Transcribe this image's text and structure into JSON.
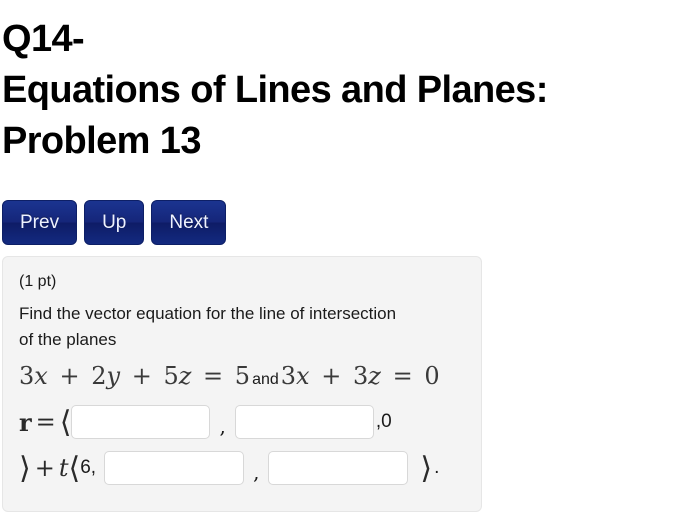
{
  "title": {
    "line1": "Q14-",
    "line2": "Equations of Lines and Planes:",
    "line3": "Problem 13"
  },
  "nav": {
    "prev_label": "Prev",
    "up_label": "Up",
    "next_label": "Next"
  },
  "problem": {
    "points": "(1 pt)",
    "prompt": "Find the vector equation for the line of intersection of the planes",
    "equation": {
      "plane1": "3x + 2y + 5z = 5",
      "conjunction": "and",
      "plane2": "3x + 3z = 0",
      "p1_c1": "3",
      "p1_v1": "x",
      "p1_op1": "+",
      "p1_c2": "2",
      "p1_v2": "y",
      "p1_op2": "+",
      "p1_c3": "5",
      "p1_v3": "z",
      "p1_eq": "=",
      "p1_rhs": "5",
      "p2_c1": "3",
      "p2_v1": "x",
      "p2_op1": "+",
      "p2_c2": "3",
      "p2_v2": "z",
      "p2_eq": "=",
      "p2_rhs": "0"
    },
    "answer": {
      "r_symbol": "r",
      "equals": "=",
      "open_angle": "⟨",
      "close_angle": "⟩",
      "comma": ",",
      "fixed_third_component": ",0",
      "plus": "+",
      "t_symbol": "t",
      "direction_first_component": "6,",
      "period": ".",
      "input1_value": "",
      "input2_value": "",
      "input3_value": "",
      "input4_value": "",
      "input_placeholder": ""
    }
  },
  "colors": {
    "button_blue": "#15267a",
    "panel_bg": "#f4f4f4",
    "panel_border": "#e6e6e6",
    "input_border": "#d8d8d8",
    "text": "#1a1a1a"
  }
}
